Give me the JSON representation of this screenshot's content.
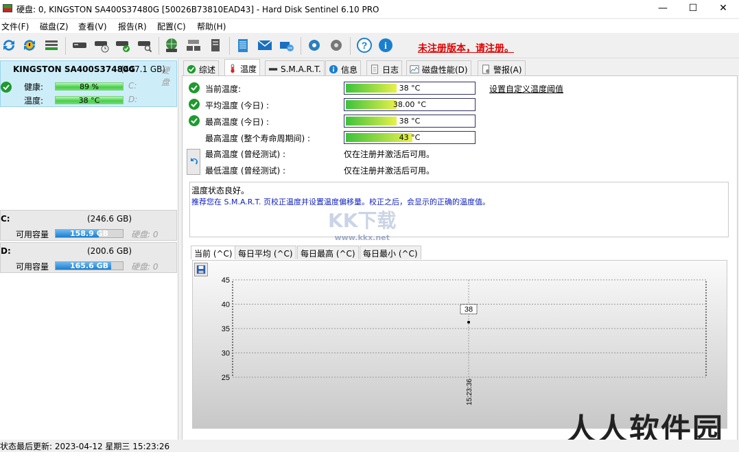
{
  "window": {
    "title": "硬盘:  0, KINGSTON SA400S37480G [50026B73810EAD43]  -  Hard Disk Sentinel 6.10 PRO",
    "minimize": "—",
    "maximize": "☐",
    "close": "✕"
  },
  "menu": {
    "items": [
      {
        "label": "文件(F)"
      },
      {
        "label": "磁盘(Z)"
      },
      {
        "label": "查看(V)"
      },
      {
        "label": "报告(R)"
      },
      {
        "label": "配置(C)"
      },
      {
        "label": "帮助(H)"
      }
    ]
  },
  "toolbar": {
    "unregistered_text": "未注册版本，请注册。",
    "icons": [
      "refresh-icon",
      "refresh-warning-icon",
      "disk-list-icon",
      "disk-icon",
      "disk-clock-icon",
      "disk-check-icon",
      "disk-search-icon",
      "globe-disk-icon",
      "network-disk-icon",
      "server-icon",
      "notepad-icon",
      "mail-icon",
      "send-icon",
      "settings-icon",
      "tools-icon",
      "help-icon",
      "info-icon"
    ]
  },
  "left_panel": {
    "disk": {
      "name": "KINGSTON SA400S37480G",
      "size": "(447.1 GB)",
      "extra": "硬盘",
      "health_label": "健康:",
      "health_value": "89 %",
      "health_fraction": 0.89,
      "health_drive": "C:",
      "temp_label": "温度:",
      "temp_value": "38 °C",
      "temp_drive": "D:"
    },
    "volumes": [
      {
        "letter": "C:",
        "total": "(246.6 GB)",
        "free_label": "可用容量",
        "free_value": "158.9 GB",
        "free_fraction": 0.644,
        "disk_label": "硬盘: 0"
      },
      {
        "letter": "D:",
        "total": "(200.6 GB)",
        "free_label": "可用容量",
        "free_value": "165.6 GB",
        "free_fraction": 0.826,
        "disk_label": "硬盘: 0"
      }
    ]
  },
  "tabs": [
    {
      "label": "综述",
      "icon": "check-icon"
    },
    {
      "label": "温度",
      "icon": "thermometer-icon"
    },
    {
      "label": "S.M.A.R.T.",
      "icon": "disk-icon"
    },
    {
      "label": "信息",
      "icon": "info-icon"
    },
    {
      "label": "日志",
      "icon": "log-icon"
    },
    {
      "label": "磁盘性能(D)",
      "icon": "chart-icon"
    },
    {
      "label": "警报(A)",
      "icon": "alert-icon"
    }
  ],
  "temperature": {
    "rows": [
      {
        "label": "当前温度:",
        "value": "38 °C",
        "fraction": 0.4
      },
      {
        "label": "平均温度 (今日) :",
        "value": "38.00 °C",
        "fraction": 0.4
      },
      {
        "label": "最高温度 (今日) :",
        "value": "38 °C",
        "fraction": 0.4
      },
      {
        "label": "最高温度 (整个寿命周期间) :",
        "value": "43 °C",
        "fraction": 0.52
      }
    ],
    "custom_link": "设置自定义温度阈值",
    "tested_rows": [
      {
        "label": "最高温度 (曾经测试) :",
        "value": "仅在注册并激活后可用。"
      },
      {
        "label": "最低温度 (曾经测试) :",
        "value": "仅在注册并激活后可用。"
      }
    ],
    "status_line1": "温度状态良好。",
    "status_line2": "推荐您在 S.M.A.R.T. 页校正温度并设置温度偏移量。校正之后，会显示的正确的温度值。"
  },
  "chart_tabs": [
    {
      "label": "当前 (^C)"
    },
    {
      "label": "每日平均 (^C)"
    },
    {
      "label": "每日最高 (^C)"
    },
    {
      "label": "每日最小 (^C)"
    }
  ],
  "chart_data": {
    "type": "line",
    "y_ticks": [
      "45",
      "40",
      "35",
      "30",
      "25"
    ],
    "ylim": [
      25,
      45
    ],
    "points": [
      {
        "x": "15:23:36",
        "y": 38
      }
    ],
    "point_label": "38",
    "x_tick": "15:23:36"
  },
  "statusbar": {
    "text": "状态最后更新:   2023-04-12 星期三 15:23:26"
  },
  "watermark": {
    "text1": "人人软件园",
    "text2": "KK下载",
    "text3": "www.kkx.net"
  }
}
